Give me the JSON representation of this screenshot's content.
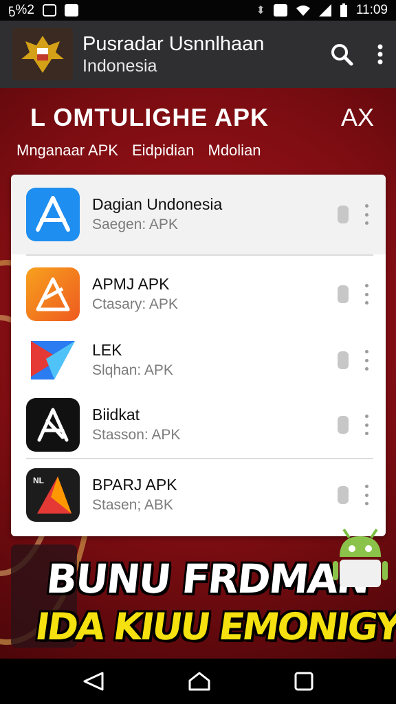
{
  "status_bar": {
    "left_text": "ҕ%2",
    "time": "11:09"
  },
  "app_bar": {
    "title": "Pusradar Usnnlhaan",
    "subtitle": "Indonesia",
    "logo_icon": "garuda-emblem-icon",
    "actions": [
      "search-icon",
      "more-vert-icon"
    ]
  },
  "promo": {
    "title": "L OMTULIGHE   APK",
    "close_label": "AX",
    "tabs": [
      "Mnganaar APK",
      "Eidpidian",
      "Mdolian"
    ]
  },
  "apps": [
    {
      "name": "Dagian Undonesia",
      "subtitle": "Saegen: APK",
      "icon": "app-store-a-icon",
      "color": "#1e8ef0"
    },
    {
      "name": "APMJ APK",
      "subtitle": "Ctasary: APK",
      "icon": "orange-a-icon",
      "color": "#f27a1e"
    },
    {
      "name": "LEK",
      "subtitle": "Slqhan: APK",
      "icon": "play-arrow-icon",
      "color": "#2a7cf0"
    },
    {
      "name": "Biidkat",
      "subtitle": "Stasson: APK",
      "icon": "black-a-icon",
      "color": "#111111"
    },
    {
      "name": "BPARJ APK",
      "subtitle": "Stasen; ABK",
      "icon": "red-triangle-icon",
      "color": "#1c1c1c"
    }
  ],
  "overlay": {
    "line1": "BUNU FRDMAN",
    "line2": "IDA KIUU EMONIGY!"
  }
}
